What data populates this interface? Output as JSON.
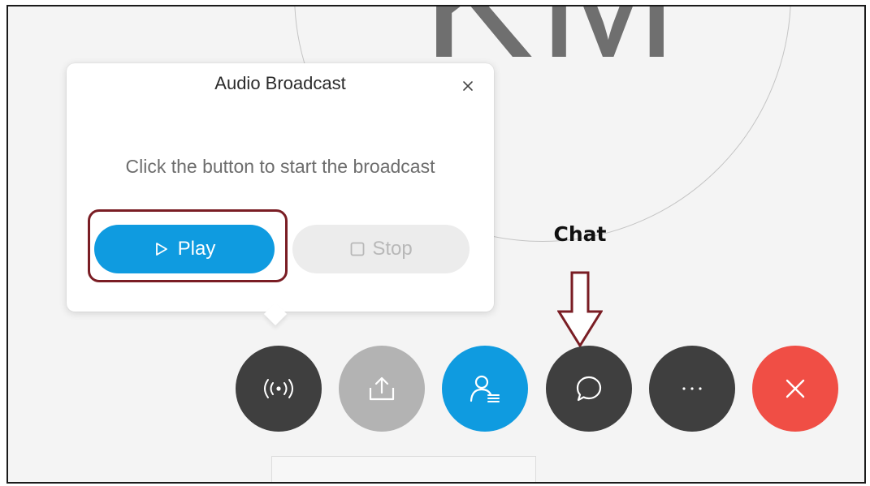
{
  "background": {
    "avatar_initials": "KM"
  },
  "popup": {
    "title": "Audio Broadcast",
    "close_icon": "close-icon",
    "message": "Click the button to start the broadcast",
    "play_label": "Play",
    "play_icon": "play-icon",
    "stop_label": "Stop",
    "stop_icon": "stop-square-icon"
  },
  "annotation": {
    "chat_label": "Chat",
    "arrow_color": "#7a1d24",
    "highlight_color": "#7a1d24"
  },
  "toolbar": {
    "buttons": [
      {
        "name": "audio-broadcast",
        "icon": "broadcast-icon",
        "color": "#3f3f3f"
      },
      {
        "name": "share",
        "icon": "share-icon",
        "color": "#b3b3b3"
      },
      {
        "name": "participants",
        "icon": "participants-icon",
        "color": "#0f9be0"
      },
      {
        "name": "chat",
        "icon": "chat-bubble-icon",
        "color": "#3f3f3f"
      },
      {
        "name": "more",
        "icon": "more-horizontal-icon",
        "color": "#3f3f3f"
      },
      {
        "name": "end",
        "icon": "close-icon",
        "color": "#f04e45"
      }
    ]
  },
  "colors": {
    "accent_blue": "#0f9be0",
    "dark_button": "#3f3f3f",
    "disabled_button": "#b3b3b3",
    "end_red": "#f04e45"
  }
}
